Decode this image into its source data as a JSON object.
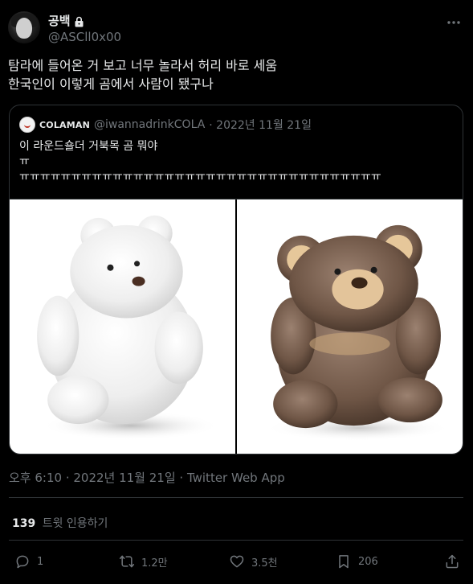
{
  "author": {
    "display_name": "공백",
    "handle": "@ASCll0x00",
    "protected_icon": "lock-icon"
  },
  "tweet": {
    "text": "탐라에 들어온 거 보고 너무 놀라서 허리 바로 세움\n한국인이 이렇게 곰에서 사람이 됐구나"
  },
  "quoted": {
    "name": "COLAMAN",
    "handle": "@iwannadrinkCOLA",
    "date": "· 2022년 11월 21일",
    "text": "이 라운드숄더 거북목 곰 뭐야\nㅠ\nㅠㅠㅠㅠㅠㅠㅠㅠㅠㅠㅠㅠㅠㅠㅠㅠㅠㅠㅠㅠㅠㅠㅠㅠㅠㅠㅠㅠㅠㅠㅠㅠㅠㅠㅠ",
    "images": [
      "white-teddy-bear-photo",
      "brown-teddy-bear-photo"
    ]
  },
  "meta": {
    "timestamp": "오후 6:10 · 2022년 11월 21일 · Twitter Web App",
    "quote_count": "139",
    "quote_label": "트윗 인용하기"
  },
  "actions": {
    "reply_count": "1",
    "retweet_count": "1.2만",
    "like_count": "3.5천",
    "bookmark_count": "206"
  },
  "colors": {
    "background": "#000000",
    "text": "#e7e9ea",
    "secondary": "#71767b",
    "border": "#2f3336"
  }
}
